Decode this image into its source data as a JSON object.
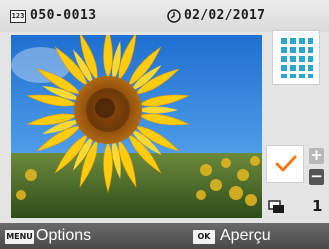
{
  "header": {
    "file_icon_text": "123",
    "file_number": "050-0013",
    "date": "02/02/2017",
    "icons": [
      "file-number-icon",
      "clock-icon"
    ]
  },
  "preview": {
    "image_subject": "sunflower"
  },
  "side_panel": {
    "layout_icon": "grid-layout-icon",
    "selected_icon": "checkmark-icon",
    "accent_color": "#f07a1a",
    "increase_label": "+",
    "decrease_label": "−",
    "copies_icon": "copies-icon",
    "copies_count": "1"
  },
  "footer": {
    "menu_key": "MENU",
    "menu_label": "Options",
    "ok_key": "OK",
    "ok_label": "Aperçu"
  }
}
